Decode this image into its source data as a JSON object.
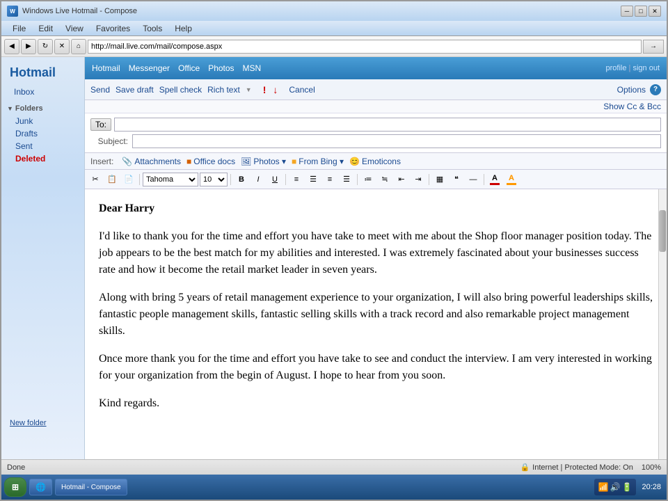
{
  "browser": {
    "title": "Windows Live Hotmail - Compose",
    "address": "http://mail.live.com/mail/compose.aspx",
    "status_left": "Done",
    "status_security": "Internet | Protected Mode: On",
    "status_zoom": "100%",
    "clock": "20:28"
  },
  "menu_bar": {
    "items": [
      "Hotmail",
      "Messenger",
      "Office",
      "Photos",
      "MSN"
    ]
  },
  "hotmail_header": {
    "brand": "Hotmail",
    "profile_link": "profile",
    "signout_link": "sign out"
  },
  "sidebar": {
    "brand": "Hotmail",
    "inbox_label": "Inbox",
    "folders_label": "Folders",
    "folder_items": [
      "Junk",
      "Drafts",
      "Sent",
      "Deleted"
    ],
    "new_folder": "New folder"
  },
  "compose": {
    "send_btn": "Send",
    "save_draft_btn": "Save draft",
    "spell_check_btn": "Spell check",
    "rich_text_btn": "Rich text",
    "cancel_btn": "Cancel",
    "options_btn": "Options",
    "show_cc_bcc": "Show Cc & Bcc",
    "to_label": "To:",
    "subject_label": "Subject:",
    "to_value": "",
    "subject_value": "",
    "insert_label": "Insert:",
    "insert_items": [
      "Attachments",
      "Office docs",
      "Photos",
      "From Bing",
      "Emoticons"
    ],
    "font": "Tahoma",
    "font_size": "10",
    "format_btns": [
      "B",
      "I",
      "U"
    ],
    "align_btns": [
      "left",
      "center",
      "right",
      "justify"
    ],
    "list_btns": [
      "ul",
      "ol",
      "indent-less",
      "indent-more"
    ],
    "body_greeting": "Dear Harry",
    "body_paragraphs": [
      "I'd like to thank you for the time and effort you have take to meet with me about the Shop floor manager position today. The job appears to be the best match for my abilities and interested. I was extremely fascinated about your businesses success rate and how it become the retail market leader in seven years.",
      "Along with bring 5 years of retail management experience to your organization, I will also bring powerful leaderships skills, fantastic people management skills, fantastic selling skills with a track record and also remarkable project management skills.",
      "Once more thank you for the time and effort you have take to see and conduct the interview. I am very interested in working for your organization from the begin of August. I hope to hear from you soon.",
      "Kind regards."
    ]
  }
}
